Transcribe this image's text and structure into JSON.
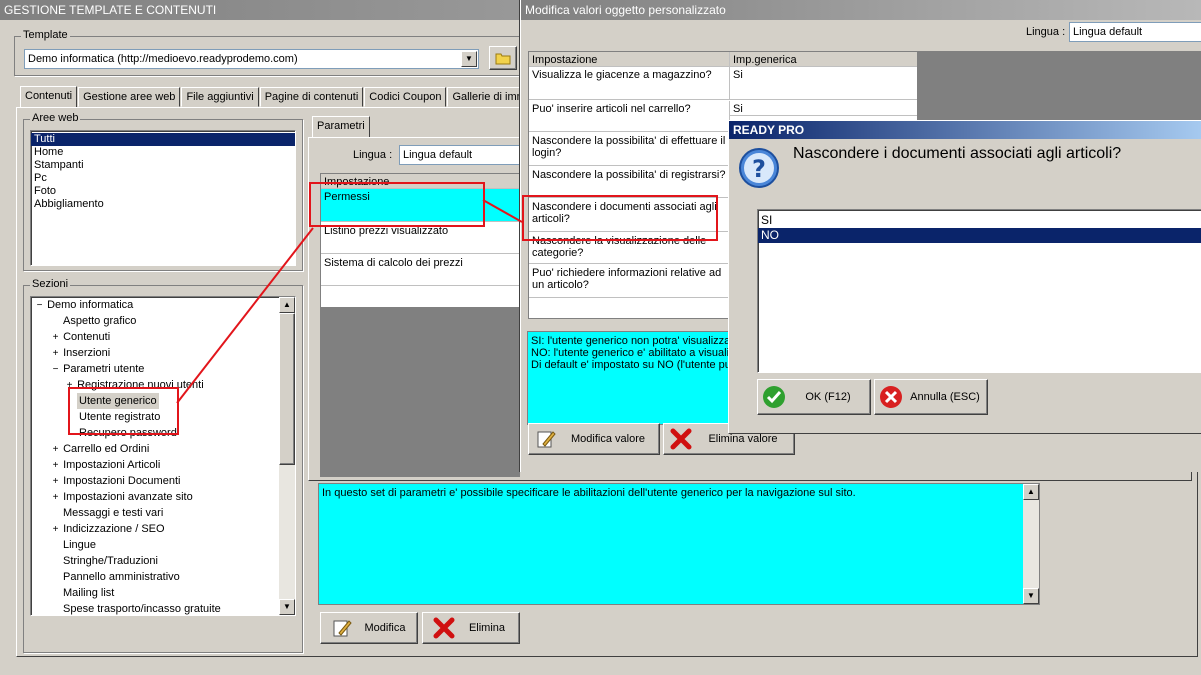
{
  "main_window": {
    "title": "GESTIONE TEMPLATE E CONTENUTI",
    "template_group_label": "Template",
    "template_value": "Demo informatica (http://medioevo.readyprodemo.com)",
    "tabs": [
      "Contenuti",
      "Gestione aree web",
      "File aggiuntivi",
      "Pagine di contenuti",
      "Codici Coupon",
      "Gallerie di imm"
    ],
    "aree_web_label": "Aree web",
    "aree_web_items": [
      "Tutti",
      "Home",
      "Stampanti",
      "Pc",
      "Foto",
      "Abbigliamento"
    ],
    "sezioni_label": "Sezioni",
    "tree": [
      "Demo informatica",
      "Aspetto grafico",
      "Contenuti",
      "Inserzioni",
      "Parametri utente",
      "Registrazione nuovi utenti",
      "Utente generico",
      "Utente registrato",
      "Recupero password",
      "Carrello ed Ordini",
      "Impostazioni Articoli",
      "Impostazioni Documenti",
      "Impostazioni avanzate sito",
      "Messaggi e testi vari",
      "Indicizzazione / SEO",
      "Lingue",
      "Stringhe/Traduzioni",
      "Pannello amministrativo",
      "Mailing list",
      "Spese trasporto/incasso gratuite"
    ],
    "parametri_tab": "Parametri",
    "lingua_label": "Lingua :",
    "lingua_value": "Lingua default",
    "grid_header": "Impostazione",
    "grid_rows": [
      "Permessi",
      "Listino prezzi visualizzato",
      "Sistema di calcolo dei prezzi"
    ],
    "description": "In questo set di parametri e' possibile specificare le abilitazioni dell'utente generico per la navigazione sul sito.",
    "modifica_button": "Modifica",
    "elimina_button": "Elimina"
  },
  "custom_window": {
    "title": "Modifica valori oggetto personalizzato",
    "lingua_label": "Lingua :",
    "lingua_value": "Lingua default",
    "col_impostazione": "Impostazione",
    "col_imp_generica": "Imp.generica",
    "rows": [
      {
        "setting": "Visualizza le giacenze a magazzino?",
        "value": "Si"
      },
      {
        "setting": "Puo' inserire articoli nel carrello?",
        "value": "Si"
      },
      {
        "setting": "Nascondere la possibilita' di effettuare il login?",
        "value": ""
      },
      {
        "setting": "Nascondere la possibilita' di registrarsi?",
        "value": ""
      },
      {
        "setting": "Nascondere i documenti associati agli articoli?",
        "value": ""
      },
      {
        "setting": "Nascondere la visualizzazione delle categorie?",
        "value": ""
      },
      {
        "setting": "Puo' richiedere informazioni relative ad un articolo?",
        "value": ""
      }
    ],
    "info_lines": [
      "SI: l'utente generico non potra' visualizza",
      "NO: l'utente generico e' abilitato a visuali",
      "Di default e' impostato su NO (l'utente pu"
    ],
    "modifica_valore_button": "Modifica valore",
    "elimina_valore_button": "Elimina valore"
  },
  "dialog": {
    "title": "READY PRO",
    "question": "Nascondere i documenti associati agli articoli?",
    "options": [
      "SI",
      "NO"
    ],
    "selected_option": "NO",
    "ok_button": "OK (F12)",
    "cancel_button": "Annulla (ESC)"
  },
  "colors": {
    "highlight": "#0a246a",
    "info_bg": "#00ffff",
    "annotation_red": "#e2151b"
  }
}
